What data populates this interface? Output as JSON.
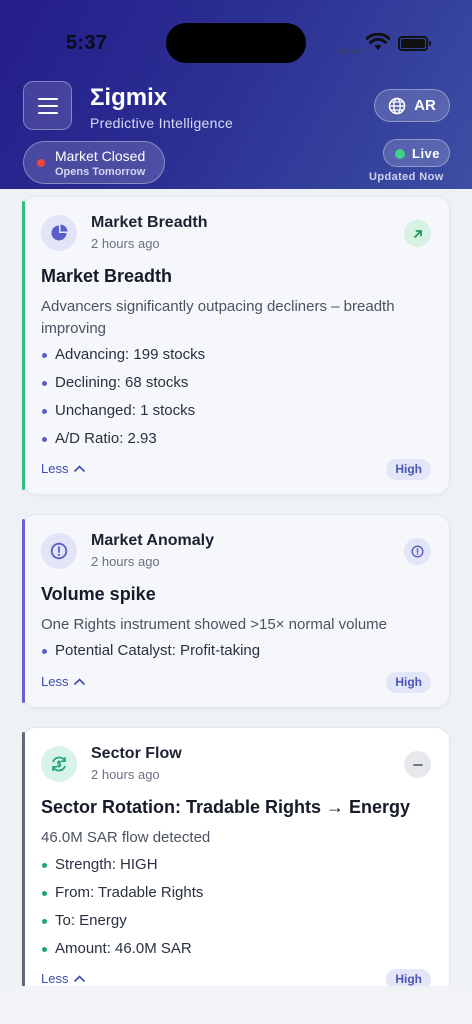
{
  "status_bar": {
    "time": "5:37"
  },
  "header": {
    "brand": "Σigmix",
    "subtitle": "Predictive Intelligence",
    "language_label": "AR",
    "market_status": "Market Closed",
    "market_substatus": "Opens Tomorrow",
    "live_label": "Live",
    "updated_label": "Updated Now",
    "colors": {
      "closed_dot": "#f0463b",
      "live_dot": "#3fd08a"
    }
  },
  "cards": [
    {
      "category": "Market Breadth",
      "time": "2 hours ago",
      "icon": "pie-chart-icon",
      "action_icon": "arrow-up-right-icon",
      "headline": "Market Breadth",
      "description": "Advancers significantly outpacing decliners – breadth improving",
      "bullets": [
        "Advancing: 199 stocks",
        "Declining: 68 stocks",
        "Unchanged: 1 stocks",
        "A/D Ratio: 2.93"
      ],
      "less_label": "Less",
      "badge": "High",
      "accent": "#2fbf78"
    },
    {
      "category": "Market Anomaly",
      "time": "2 hours ago",
      "icon": "alert-circle-icon",
      "action_icon": "info-circle-icon",
      "headline": "Volume spike",
      "description": "One Rights instrument showed >15× normal volume",
      "bullets": [
        "Potential Catalyst: Profit-taking"
      ],
      "less_label": "Less",
      "badge": "High",
      "accent": "#6b61d6"
    },
    {
      "category": "Sector Flow",
      "time": "2 hours ago",
      "icon": "rotate-dollar-icon",
      "action_icon": "minus-icon",
      "headline": "Sector Rotation: Tradable Rights → Energy",
      "description": "46.0M SAR flow detected",
      "bullets": [
        "Strength: HIGH",
        "From: Tradable Rights",
        "To: Energy",
        "Amount: 46.0M SAR"
      ],
      "less_label": "Less",
      "badge": "High",
      "accent": "#5e6878"
    }
  ]
}
